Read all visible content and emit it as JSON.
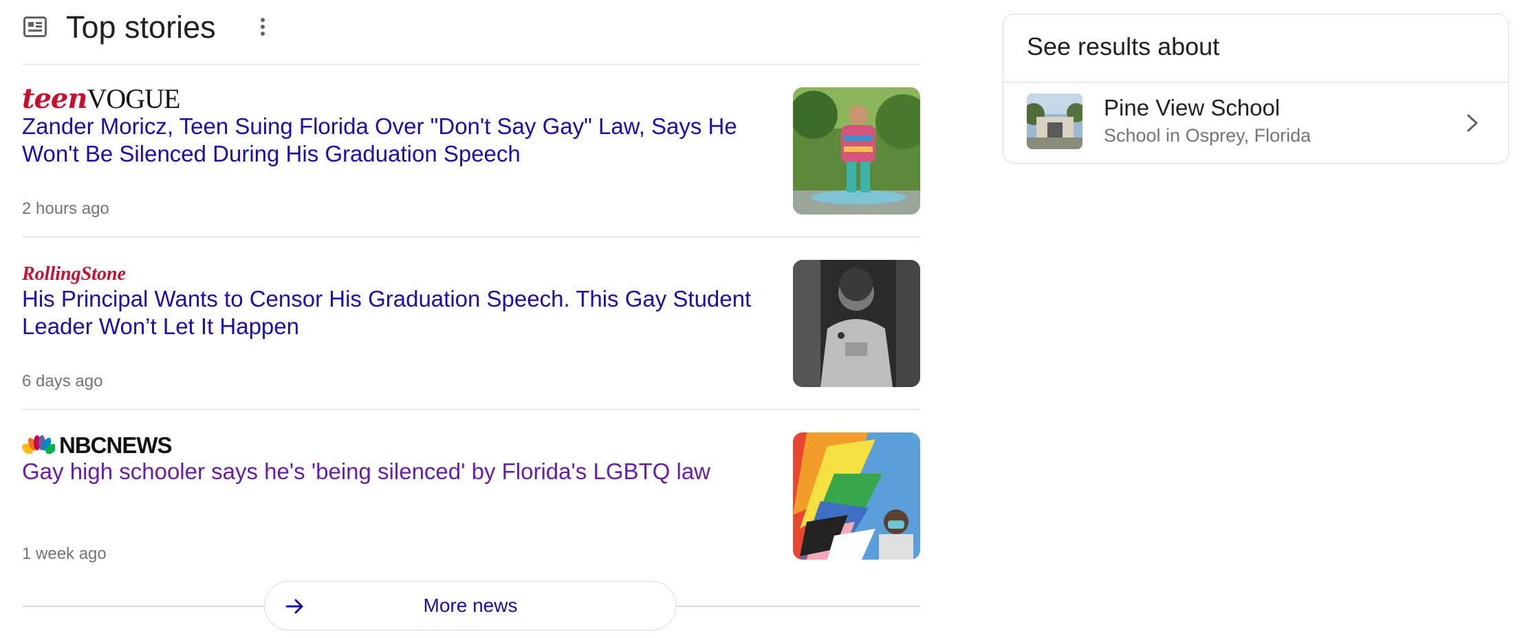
{
  "top_stories": {
    "title": "Top stories",
    "icon": "news-icon",
    "more_options_icon": "kebab-menu-icon"
  },
  "stories": [
    {
      "source": "Teen Vogue",
      "logo_parts": {
        "a": "teen",
        "b": "VOGUE"
      },
      "headline": "Zander Moricz, Teen Suing Florida Over \"Don't Say Gay\" Law, Says He Won't Be Silenced During His Graduation Speech",
      "time": "2 hours ago",
      "visited": false
    },
    {
      "source": "RollingStone",
      "logo_text": "RollingStone",
      "headline": "His Principal Wants to Censor His Graduation Speech. This Gay Student Leader Won’t Let It Happen",
      "time": "6 days ago",
      "visited": false
    },
    {
      "source": "NBC News",
      "logo_text": "NBCNEWS",
      "headline": "Gay high schooler says he's 'being silenced' by Florida's LGBTQ law",
      "time": "1 week ago",
      "visited": true
    }
  ],
  "more_news": {
    "label": "More news",
    "icon": "arrow-right-icon"
  },
  "see_results": {
    "title": "See results about",
    "entity_name": "Pine View School",
    "entity_subtitle": "School in Osprey, Florida",
    "chevron_icon": "chevron-right-icon"
  },
  "colors": {
    "link": "#1a0dab",
    "visited_link": "#681da8",
    "meta_text": "#70757a",
    "divider": "#dadce0"
  }
}
